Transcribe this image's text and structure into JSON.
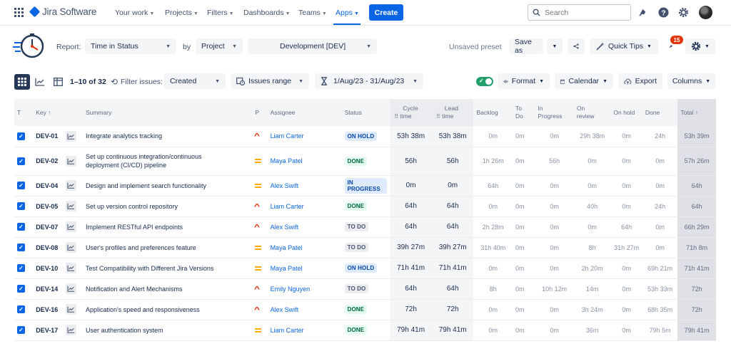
{
  "nav": {
    "brand": "Jira Software",
    "items": [
      "Your work",
      "Projects",
      "Filters",
      "Dashboards",
      "Teams",
      "Apps"
    ],
    "create_label": "Create",
    "search_placeholder": "Search"
  },
  "report": {
    "report_label": "Report:",
    "report_value": "Time in Status",
    "by_label": "by",
    "by_value": "Project",
    "project_value": "Development [DEV]",
    "unsaved_preset": "Unsaved preset",
    "save_as": "Save as",
    "quick_tips": "Quick Tips",
    "notification_count": "15"
  },
  "filters": {
    "range_text": "1–10 of 32",
    "filter_issues_label": "Filter issues:",
    "filter_field": "Created",
    "issues_range": "Issues range",
    "date_range": "1/Aug/23 - 31/Aug/23",
    "format": "Format",
    "calendar": "Calendar",
    "export": "Export",
    "columns": "Columns"
  },
  "table": {
    "headers": {
      "t": "T",
      "key": "Key",
      "summary": "Summary",
      "p": "P",
      "assignee": "Assignee",
      "status": "Status",
      "cycle1": "Cycle",
      "cycle2": "time",
      "lead1": "Lead",
      "lead2": "time",
      "backlog": "Backlog",
      "todo1": "To",
      "todo2": "Do",
      "inprog1": "In",
      "inprog2": "Progress",
      "onrev1": "On",
      "onrev2": "review",
      "onhold": "On hold",
      "done": "Done",
      "total": "Total"
    },
    "rows": [
      {
        "key": "DEV-01",
        "summary": "Integrate analytics tracking",
        "summary2": "",
        "priority": "high",
        "assignee": "Liam Carter",
        "status": "ON HOLD",
        "status_class": "st-onhold",
        "cycle": "53h 38m",
        "lead": "53h 38m",
        "backlog": "0m",
        "todo": "0m",
        "inprog": "0m",
        "onrev": "29h 38m",
        "onhold": "0m",
        "done": "24h",
        "total": "53h 39m"
      },
      {
        "key": "DEV-02",
        "summary": "Set up continuous integration/continuous",
        "summary2": "deployment (CI/CD) pipeline",
        "priority": "medium",
        "assignee": "Maya Patel",
        "status": "DONE",
        "status_class": "st-done",
        "cycle": "56h",
        "lead": "56h",
        "backlog": "1h 26m",
        "todo": "0m",
        "inprog": "56h",
        "onrev": "0m",
        "onhold": "0m",
        "done": "0m",
        "total": "57h 26m"
      },
      {
        "key": "DEV-04",
        "summary": "Design and implement search functionality",
        "summary2": "",
        "priority": "medium",
        "assignee": "Alex Swift",
        "status": "IN PROGRESS",
        "status_class": "st-progress",
        "cycle": "0m",
        "lead": "0m",
        "backlog": "64h",
        "todo": "0m",
        "inprog": "0m",
        "onrev": "0m",
        "onhold": "0m",
        "done": "0m",
        "total": "64h"
      },
      {
        "key": "DEV-05",
        "summary": "Set up version control repository",
        "summary2": "",
        "priority": "high",
        "assignee": "Liam Carter",
        "status": "DONE",
        "status_class": "st-done",
        "cycle": "64h",
        "lead": "64h",
        "backlog": "0m",
        "todo": "0m",
        "inprog": "0m",
        "onrev": "40h",
        "onhold": "0m",
        "done": "24h",
        "total": "64h"
      },
      {
        "key": "DEV-07",
        "summary": "Implement RESTful API endpoints",
        "summary2": "",
        "priority": "high",
        "assignee": "Alex Swift",
        "status": "TO DO",
        "status_class": "st-todo",
        "cycle": "64h",
        "lead": "64h",
        "backlog": "2h 28m",
        "todo": "0m",
        "inprog": "0m",
        "onrev": "0m",
        "onhold": "64h",
        "done": "0m",
        "total": "66h 29m"
      },
      {
        "key": "DEV-08",
        "summary": "User's profiles and preferences feature",
        "summary2": "",
        "priority": "medium",
        "assignee": "Maya Patel",
        "status": "TO DO",
        "status_class": "st-todo",
        "cycle": "39h 27m",
        "lead": "39h 27m",
        "backlog": "31h 40m",
        "todo": "0m",
        "inprog": "0m",
        "onrev": "8h",
        "onhold": "31h 27m",
        "done": "0m",
        "total": "71h 8m"
      },
      {
        "key": "DEV-10",
        "summary": "Test Compatibility with Different Jira Versions",
        "summary2": "",
        "priority": "medium",
        "assignee": "Maya Patel",
        "status": "ON HOLD",
        "status_class": "st-onhold",
        "cycle": "71h 41m",
        "lead": "71h 41m",
        "backlog": "0m",
        "todo": "0m",
        "inprog": "0m",
        "onrev": "2h 20m",
        "onhold": "0m",
        "done": "69h 21m",
        "total": "71h 41m"
      },
      {
        "key": "DEV-14",
        "summary": "Notification and Alert Mechanisms",
        "summary2": "",
        "priority": "high",
        "assignee": "Emily Nguyen",
        "status": "TO DO",
        "status_class": "st-todo",
        "cycle": "64h",
        "lead": "64h",
        "backlog": "8h",
        "todo": "0m",
        "inprog": "10h 12m",
        "onrev": "14m",
        "onhold": "0m",
        "done": "53h 33m",
        "total": "72h"
      },
      {
        "key": "DEV-16",
        "summary": "Application's speed and responsiveness",
        "summary2": "",
        "priority": "high",
        "assignee": "Alex Swift",
        "status": "DONE",
        "status_class": "st-done",
        "cycle": "72h",
        "lead": "72h",
        "backlog": "0m",
        "todo": "0m",
        "inprog": "0m",
        "onrev": "3h 24m",
        "onhold": "0m",
        "done": "68h 35m",
        "total": "72h"
      },
      {
        "key": "DEV-17",
        "summary": "User authentication system",
        "summary2": "",
        "priority": "medium",
        "assignee": "Liam Carter",
        "status": "DONE",
        "status_class": "st-done",
        "cycle": "79h 41m",
        "lead": "79h 41m",
        "backlog": "0m",
        "todo": "0m",
        "inprog": "0m",
        "onrev": "36m",
        "onhold": "0m",
        "done": "79h 5m",
        "total": "79h 41m"
      }
    ]
  },
  "colors": {
    "accent": "#0c66e4",
    "toggle_on": "#22a06b",
    "badge": "#de350b"
  }
}
